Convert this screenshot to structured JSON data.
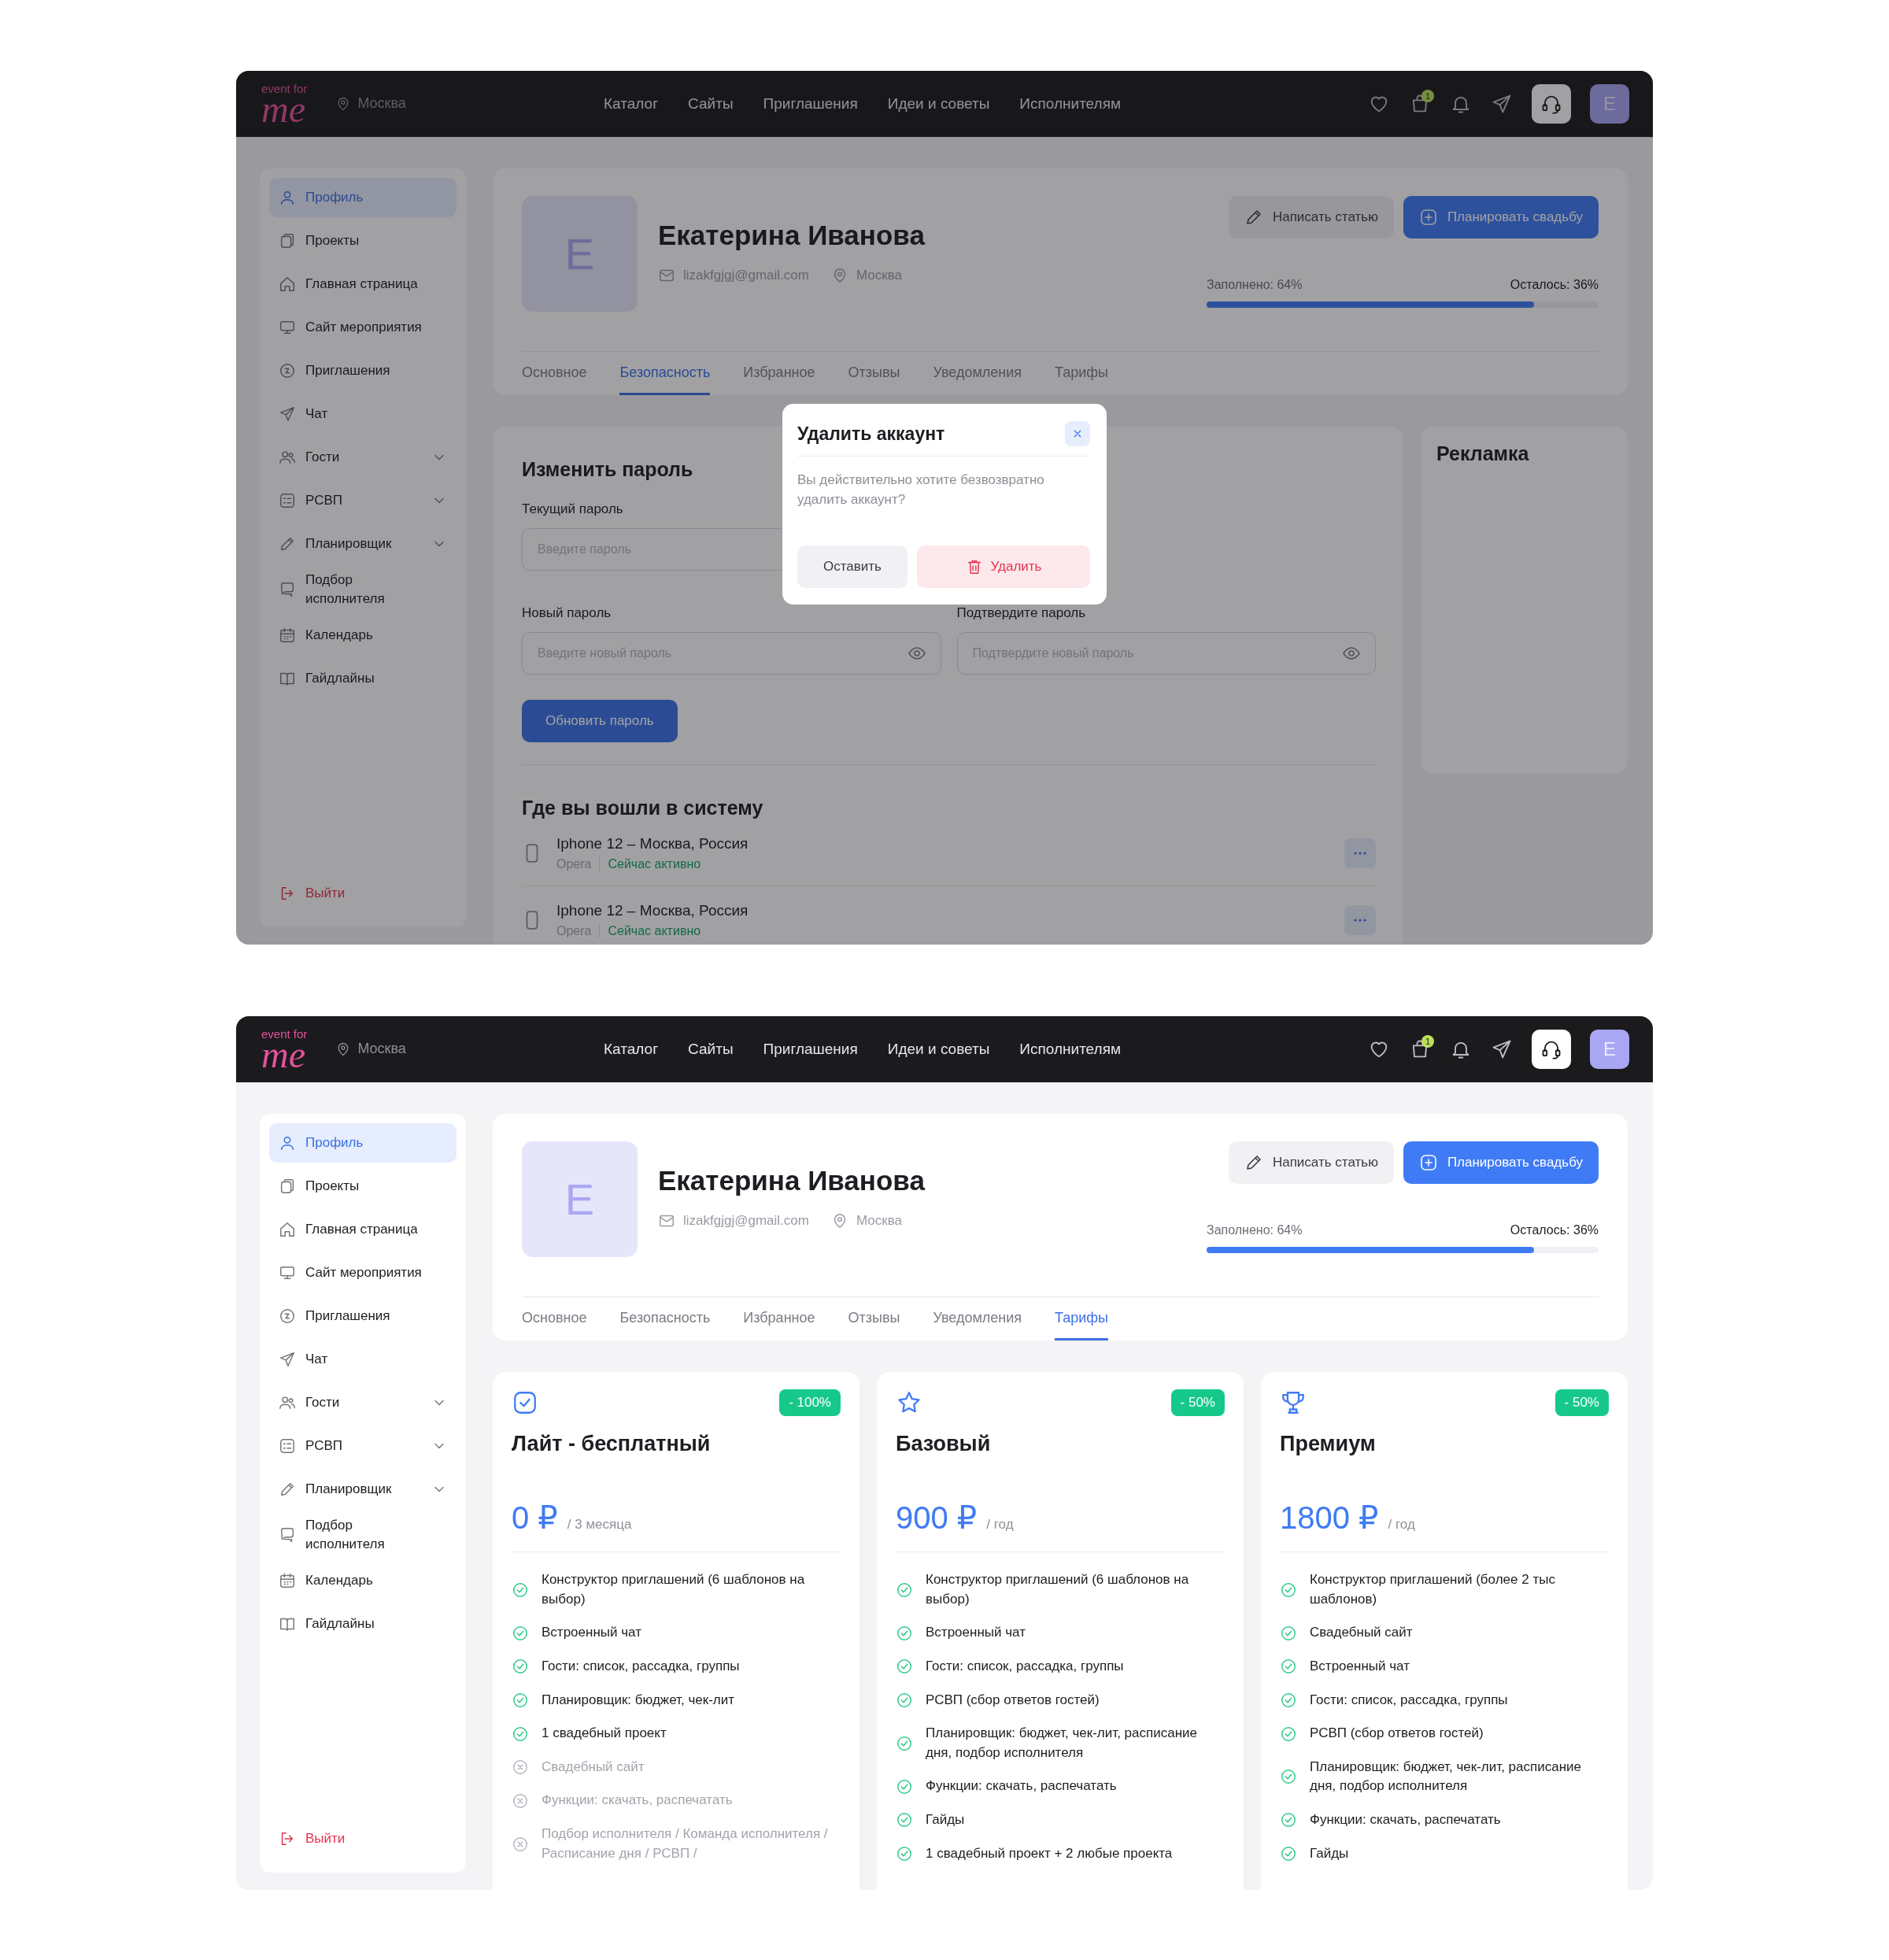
{
  "screens": [
    {
      "header": {
        "logo_top": "event for",
        "logo_main": "me",
        "location": "Москва",
        "nav": [
          "Каталог",
          "Сайты",
          "Приглашения",
          "Идеи и советы",
          "Исполнителям"
        ],
        "cart_badge": "1",
        "avatar": "E"
      },
      "sidebar": {
        "items": [
          {
            "label": "Профиль",
            "selected": true,
            "expandable": false
          },
          {
            "label": "Проекты",
            "selected": false,
            "expandable": false
          },
          {
            "label": "Главная страница",
            "selected": false,
            "expandable": false
          },
          {
            "label": "Сайт мероприятия",
            "selected": false,
            "expandable": false
          },
          {
            "label": "Приглашения",
            "selected": false,
            "expandable": false
          },
          {
            "label": "Чат",
            "selected": false,
            "expandable": false
          },
          {
            "label": "Гости",
            "selected": false,
            "expandable": true
          },
          {
            "label": "РСВП",
            "selected": false,
            "expandable": true
          },
          {
            "label": "Планировщик",
            "selected": false,
            "expandable": true
          },
          {
            "label": "Подбор исполнителя",
            "selected": false,
            "expandable": false
          },
          {
            "label": "Календарь",
            "selected": false,
            "expandable": false
          },
          {
            "label": "Гайдлайны",
            "selected": false,
            "expandable": false
          }
        ],
        "logout": "Выйти"
      },
      "profile": {
        "avatar": "E",
        "name": "Екатерина Иванова",
        "email": "lizakfgjgj@gmail.com",
        "city": "Москва",
        "buttons": [
          {
            "label": "Написать статью",
            "kind": "secondary"
          },
          {
            "label": "Планировать свадьбу",
            "kind": "primary"
          }
        ],
        "filled": "Заполнено: 64%",
        "remaining": "Осталось: 36%",
        "progress": {
          "level": 0.835
        },
        "tabs": [
          {
            "label": "Основное",
            "selected": false
          },
          {
            "label": "Безопасность",
            "selected": true
          },
          {
            "label": "Избранное",
            "selected": false
          },
          {
            "label": "Отзывы",
            "selected": false
          },
          {
            "label": "Уведомления",
            "selected": false
          },
          {
            "label": "Тарифы",
            "selected": false
          }
        ]
      },
      "content": {
        "kind": "security",
        "title": "Изменить пароль",
        "fields": [
          {
            "label": "Текущий пароль",
            "placeholder": "Введите пароль"
          },
          {
            "label": "Новый пароль",
            "placeholder": "Введите новый пароль",
            "reveal": true
          },
          {
            "label": "Подтвердите пароль",
            "placeholder": "Подтвердите новый пароль",
            "reveal": true
          }
        ],
        "submit": "Обновить пароль",
        "sessions_title": "Где вы вошли в систему",
        "sessions": [
          {
            "device": "Iphone 12 – Москва, Россия",
            "browser": "Opera",
            "status": "Сейчас активно"
          },
          {
            "device": "Iphone 12 – Москва, Россия",
            "browser": "Opera",
            "status": "Сейчас активно"
          }
        ],
        "ad_title": "Рекламка"
      },
      "modal": {
        "title": "Удалить аккаунт",
        "message": "Вы действительно хотите безвозвратно удалить аккаунт?",
        "buttons": [
          {
            "label": "Оставить",
            "kind": "cancel"
          },
          {
            "label": "Удалить",
            "kind": "danger"
          }
        ]
      }
    },
    {
      "header": {
        "logo_top": "event for",
        "logo_main": "me",
        "location": "Москва",
        "nav": [
          "Каталог",
          "Сайты",
          "Приглашения",
          "Идеи и советы",
          "Исполнителям"
        ],
        "cart_badge": "1",
        "avatar": "E"
      },
      "sidebar": {
        "items": [
          {
            "label": "Профиль",
            "selected": true,
            "expandable": false
          },
          {
            "label": "Проекты",
            "selected": false,
            "expandable": false
          },
          {
            "label": "Главная страница",
            "selected": false,
            "expandable": false
          },
          {
            "label": "Сайт мероприятия",
            "selected": false,
            "expandable": false
          },
          {
            "label": "Приглашения",
            "selected": false,
            "expandable": false
          },
          {
            "label": "Чат",
            "selected": false,
            "expandable": false
          },
          {
            "label": "Гости",
            "selected": false,
            "expandable": true
          },
          {
            "label": "РСВП",
            "selected": false,
            "expandable": true
          },
          {
            "label": "Планировщик",
            "selected": false,
            "expandable": true
          },
          {
            "label": "Подбор исполнителя",
            "selected": false,
            "expandable": false
          },
          {
            "label": "Календарь",
            "selected": false,
            "expandable": false
          },
          {
            "label": "Гайдлайны",
            "selected": false,
            "expandable": false
          }
        ],
        "logout": "Выйти"
      },
      "profile": {
        "avatar": "E",
        "name": "Екатерина Иванова",
        "email": "lizakfgjgj@gmail.com",
        "city": "Москва",
        "buttons": [
          {
            "label": "Написать статью",
            "kind": "secondary"
          },
          {
            "label": "Планировать свадьбу",
            "kind": "primary"
          }
        ],
        "filled": "Заполнено: 64%",
        "remaining": "Осталось: 36%",
        "progress": {
          "level": 0.835
        },
        "tabs": [
          {
            "label": "Основное",
            "selected": false
          },
          {
            "label": "Безопасность",
            "selected": false
          },
          {
            "label": "Избранное",
            "selected": false
          },
          {
            "label": "Отзывы",
            "selected": false
          },
          {
            "label": "Уведомления",
            "selected": false
          },
          {
            "label": "Тарифы",
            "selected": true
          }
        ]
      },
      "content": {
        "kind": "tariffs",
        "plans": [
          {
            "title": "Лайт - бесплатный",
            "discount": "- 100%",
            "price": "0 ₽",
            "period": "/ 3 месяца",
            "features": [
              {
                "text": "Конструктор приглашений (6 шаблонов на выбор)",
                "included": true
              },
              {
                "text": "Встроенный чат",
                "included": true
              },
              {
                "text": "Гости: список, рассадка, группы",
                "included": true
              },
              {
                "text": "Планировщик: бюджет, чек-лит",
                "included": true
              },
              {
                "text": "1 свадебный проект",
                "included": true
              },
              {
                "text": "Свадебный сайт",
                "included": false
              },
              {
                "text": "Функции: скачать, распечатать",
                "included": false
              },
              {
                "text": "Подбор исполнителя / Команда исполнителя / Расписание дня / РСВП /",
                "included": false
              }
            ]
          },
          {
            "title": "Базовый",
            "discount": "- 50%",
            "price": "900 ₽",
            "period": "/ год",
            "features": [
              {
                "text": "Конструктор приглашений (6 шаблонов на выбор)",
                "included": true
              },
              {
                "text": "Встроенный чат",
                "included": true
              },
              {
                "text": "Гости: список, рассадка, группы",
                "included": true
              },
              {
                "text": "РСВП (сбор ответов гостей)",
                "included": true
              },
              {
                "text": "Планировщик: бюджет, чек-лит, расписание дня, подбор исполнителя",
                "included": true
              },
              {
                "text": "Функции: скачать, распечатать",
                "included": true
              },
              {
                "text": "Гайды",
                "included": true
              },
              {
                "text": "1 свадебный проект  + 2 любые проекта",
                "included": true
              }
            ]
          },
          {
            "title": "Премиум",
            "discount": "- 50%",
            "price": "1800 ₽",
            "period": "/ год",
            "features": [
              {
                "text": "Конструктор приглашений (более 2 тыс шаблонов)",
                "included": true
              },
              {
                "text": "Свадебный сайт",
                "included": true
              },
              {
                "text": "Встроенный чат",
                "included": true
              },
              {
                "text": "Гости: список, рассадка, группы",
                "included": true
              },
              {
                "text": "РСВП (сбор ответов гостей)",
                "included": true
              },
              {
                "text": "Планировщик: бюджет, чек-лит, расписание дня, подбор исполнителя",
                "included": true
              },
              {
                "text": "Функции: скачать, распечатать",
                "included": true
              },
              {
                "text": "Гайды",
                "included": true
              }
            ]
          }
        ]
      }
    }
  ]
}
